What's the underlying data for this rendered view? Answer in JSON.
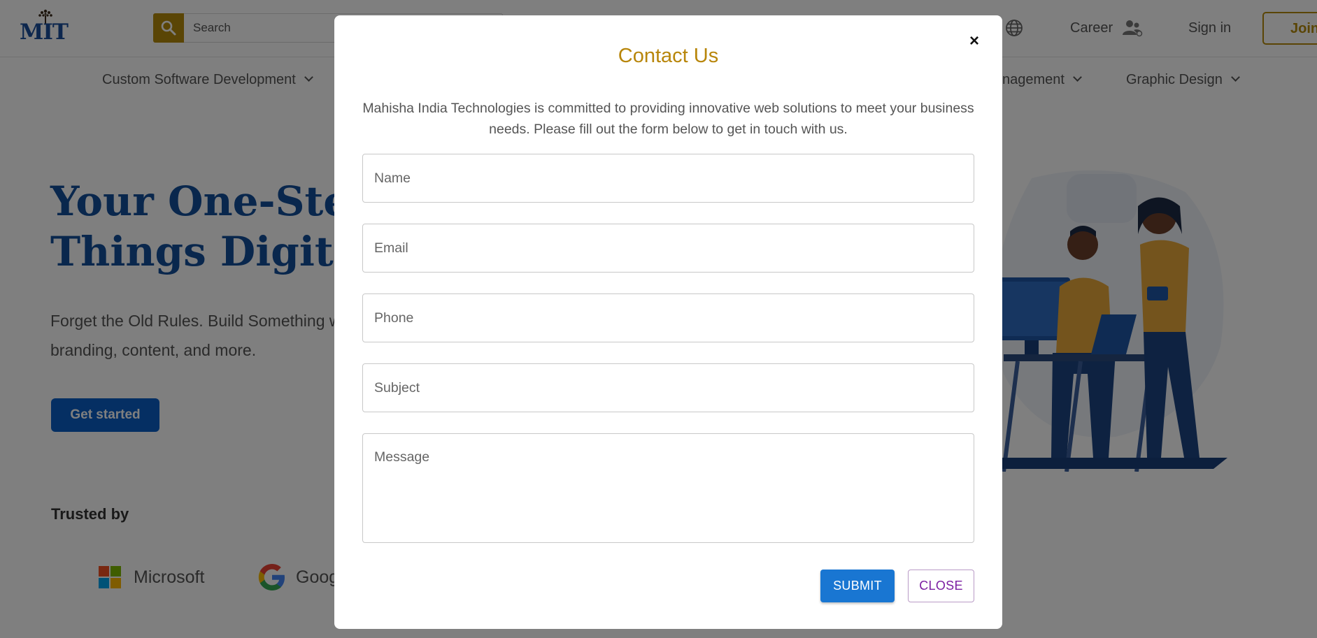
{
  "header": {
    "logo_text": "MIT",
    "search": {
      "placeholder": "Search"
    },
    "career_label": "Career",
    "signin_label": "Sign in",
    "join_label": "Join"
  },
  "nav": {
    "items": [
      {
        "label": "Custom Software Development"
      },
      {
        "label": "nagement"
      },
      {
        "label": "Graphic Design"
      }
    ]
  },
  "hero": {
    "title_line1": "Your One-Ste",
    "title_line2": "Things Digita",
    "subtitle": "Forget the Old Rules. Build Something web, branding, content, and more.",
    "cta_label": "Get started",
    "trusted_label": "Trusted by",
    "brands": [
      {
        "name": "Microsoft",
        "icon": "microsoft-logo"
      },
      {
        "name": "Goog",
        "icon": "google-logo"
      }
    ]
  },
  "modal": {
    "title": "Contact Us",
    "close_symbol": "×",
    "description": "Mahisha India Technologies is committed to providing innovative web solutions to meet your business needs. Please fill out the form below to get in touch with us.",
    "fields": {
      "name": {
        "placeholder": "Name",
        "value": ""
      },
      "email": {
        "placeholder": "Email",
        "value": ""
      },
      "phone": {
        "placeholder": "Phone",
        "value": ""
      },
      "subject": {
        "placeholder": "Subject",
        "value": ""
      },
      "message": {
        "placeholder": "Message",
        "value": ""
      }
    },
    "submit_label": "SUBMIT",
    "close_label": "CLOSE"
  },
  "colors": {
    "brand_gold": "#b58a0b",
    "brand_blue": "#134e9a",
    "submit_blue": "#1976d2",
    "close_purple": "#7b1fa2"
  }
}
